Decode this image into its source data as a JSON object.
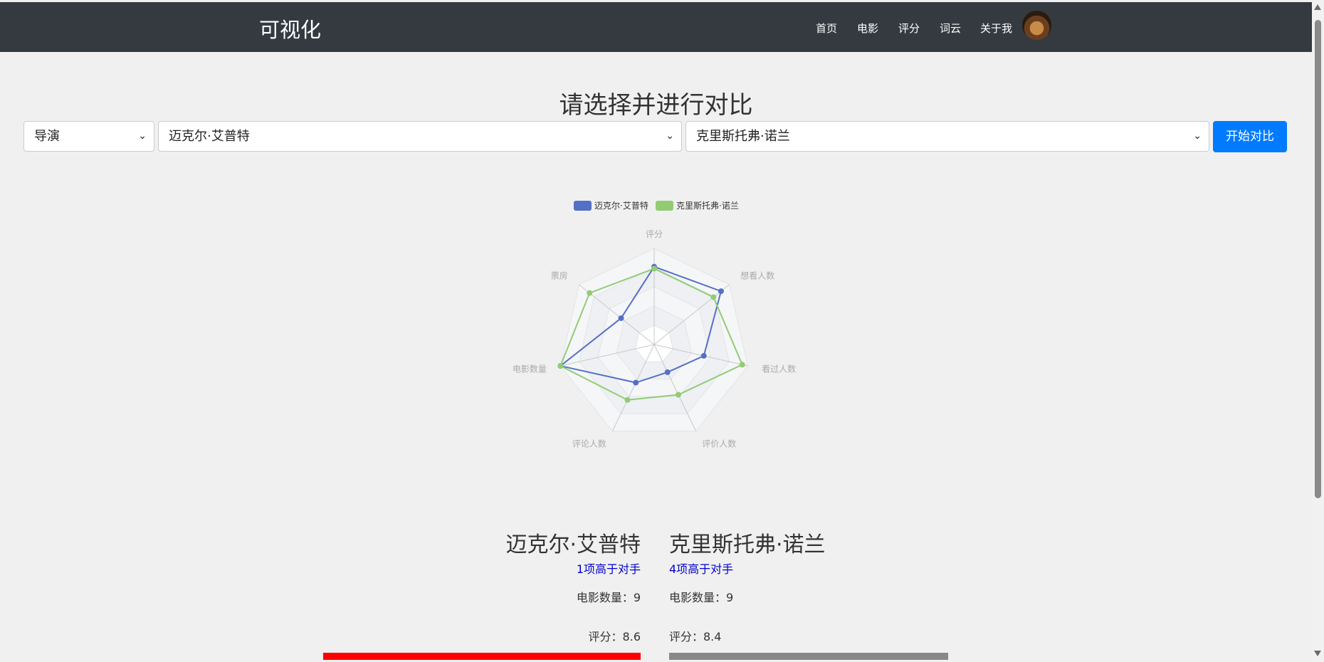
{
  "navbar": {
    "brand": "可视化",
    "items": [
      "首页",
      "电影",
      "评分",
      "词云",
      "关于我"
    ]
  },
  "page_title": "请选择并进行对比",
  "controls": {
    "category": "导演",
    "person_a": "迈克尔·艾普特",
    "person_b": "克里斯托弗·诺兰",
    "compare_button": "开始对比"
  },
  "chart_data": {
    "type": "radar",
    "indicators": [
      "评分",
      "想看人数",
      "看过人数",
      "评价人数",
      "评论人数",
      "电影数量",
      "票房"
    ],
    "series": [
      {
        "name": "迈克尔·艾普特",
        "color": "#5470c6",
        "values": [
          0.81,
          0.89,
          0.53,
          0.32,
          0.44,
          1.0,
          0.44
        ]
      },
      {
        "name": "克里斯托弗·诺兰",
        "color": "#91cc75",
        "values": [
          0.79,
          0.79,
          0.94,
          0.58,
          0.64,
          1.0,
          0.86
        ]
      }
    ]
  },
  "comparison": {
    "left": {
      "name": "迈克尔·艾普特",
      "higher": "1项高于对手",
      "movie_count": "电影数量：9",
      "score": "评分：8.6",
      "score_bar_color": "#ff0000",
      "score_bar_fraction": 1.0
    },
    "right": {
      "name": "克里斯托弗·诺兰",
      "higher": "4项高于对手",
      "movie_count": "电影数量：9",
      "score": "评分：8.4",
      "score_bar_color": "#888888",
      "score_bar_fraction": 0.977
    }
  }
}
